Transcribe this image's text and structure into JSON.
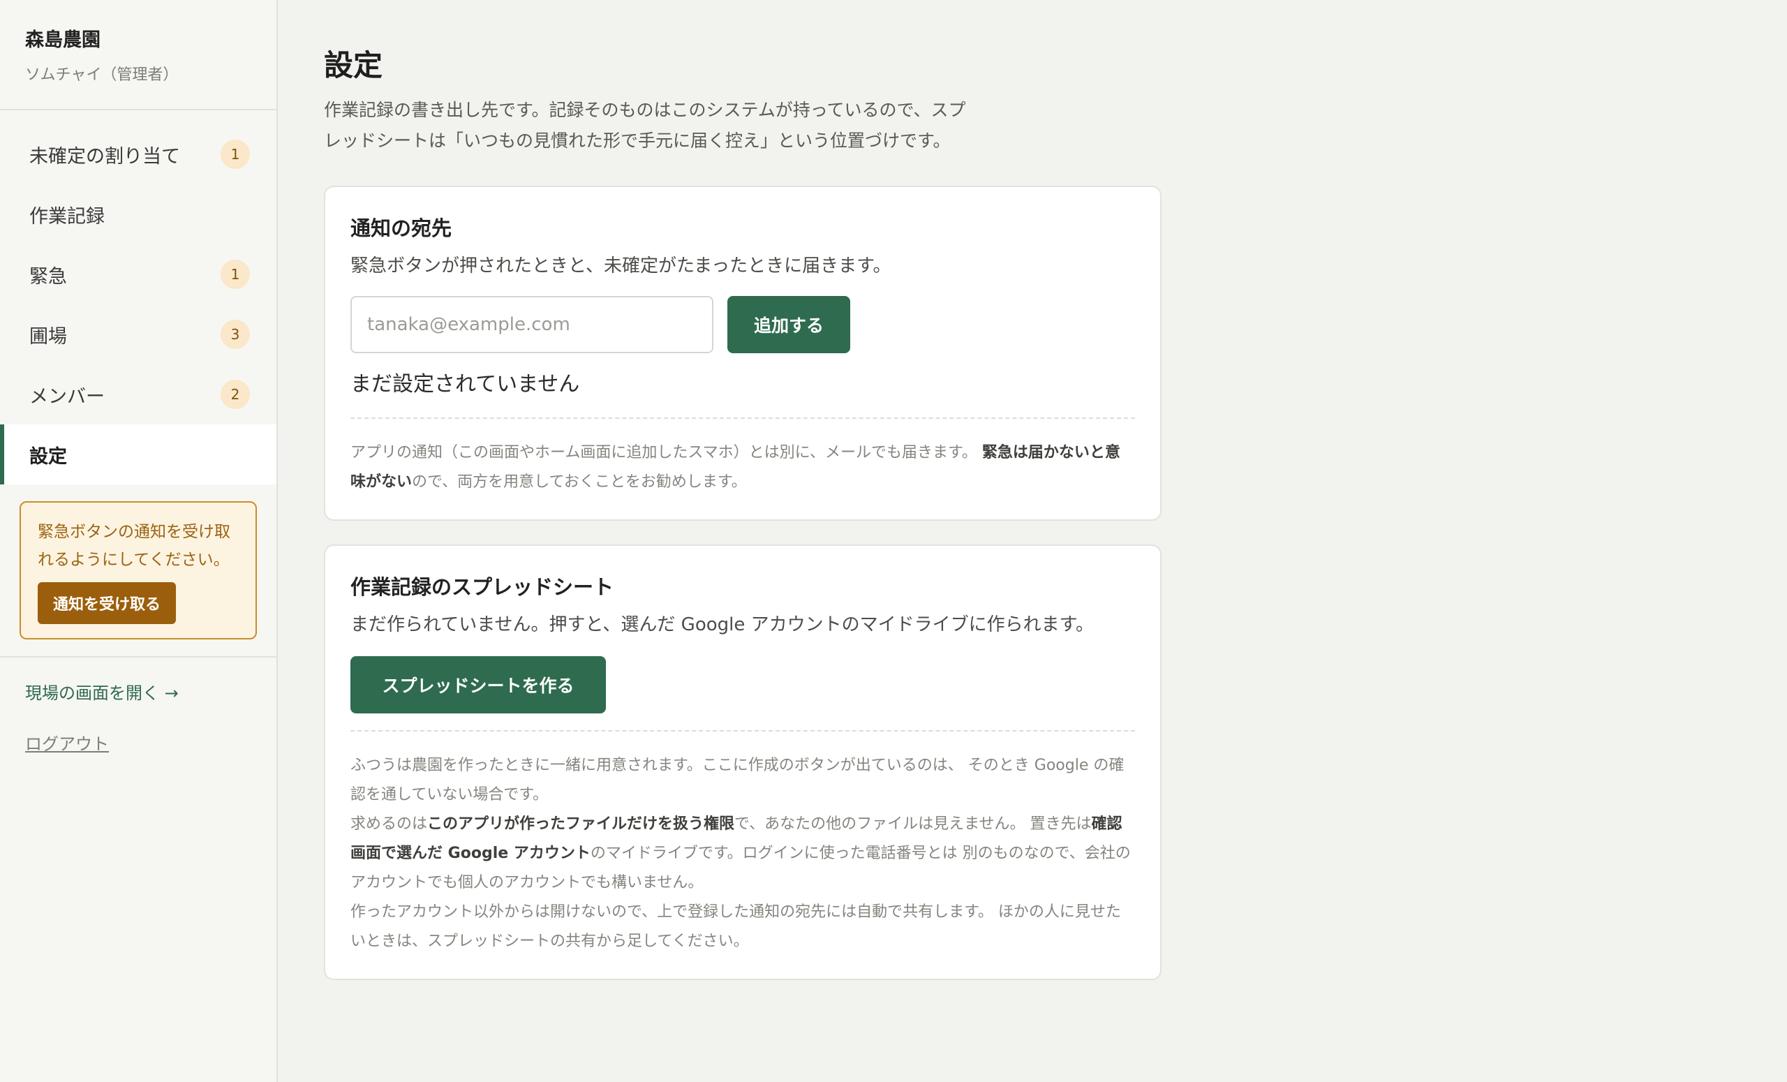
{
  "sidebar": {
    "brand_name": "森島農園",
    "user": "ソムチャイ（管理者）",
    "items": [
      {
        "label": "未確定の割り当て",
        "badge": "1"
      },
      {
        "label": "作業記録",
        "badge": ""
      },
      {
        "label": "緊急",
        "badge": "1"
      },
      {
        "label": "圃場",
        "badge": "3"
      },
      {
        "label": "メンバー",
        "badge": "2"
      },
      {
        "label": "設定",
        "badge": ""
      }
    ],
    "active_item": "設定",
    "alert": {
      "text": "緊急ボタンの通知を受け取れるようにしてください。",
      "button": "通知を受け取る"
    },
    "open_site_link": "現場の画面を開く →",
    "logout": "ログアウト"
  },
  "main": {
    "title": "設定",
    "description": "作業記録の書き出し先です。記録そのものはこのシステムが持っているので、スプレッドシートは「いつもの見慣れた形で手元に届く控え」という位置づけです。",
    "notify": {
      "title": "通知の宛先",
      "subtitle": "緊急ボタンが押されたときと、未確定がたまったときに届きます。",
      "input_placeholder": "tanaka@example.com",
      "add_button": "追加する",
      "empty": "まだ設定されていません",
      "note_pre": "アプリの通知（この画面やホーム画面に追加したスマホ）とは別に、メールでも届きます。 ",
      "note_bold": "緊急は届かないと意味がない",
      "note_post": "ので、両方を用意しておくことをお勧めします。"
    },
    "sheet": {
      "title": "作業記録のスプレッドシート",
      "subtitle": "まだ作られていません。押すと、選んだ Google アカウントのマイドライブに作られます。",
      "button": "スプレッドシートを作る",
      "note1": "ふつうは農園を作ったときに一緒に用意されます。ここに作成のボタンが出ているのは、 そのとき Google の確認を通していない場合です。",
      "note2_pre": "求めるのは",
      "note2_bold1": "このアプリが作ったファイルだけを扱う権限",
      "note2_mid": "で、あなたの他のファイルは見えません。 置き先は",
      "note2_bold2": "確認画面で選んだ Google アカウント",
      "note2_post": "のマイドライブです。ログインに使った電話番号とは 別のものなので、会社のアカウントでも個人のアカウントでも構いません。",
      "note3": "作ったアカウント以外からは開けないので、上で登録した通知の宛先には自動で共有します。 ほかの人に見せたいときは、スプレッドシートの共有から足してください。"
    }
  }
}
